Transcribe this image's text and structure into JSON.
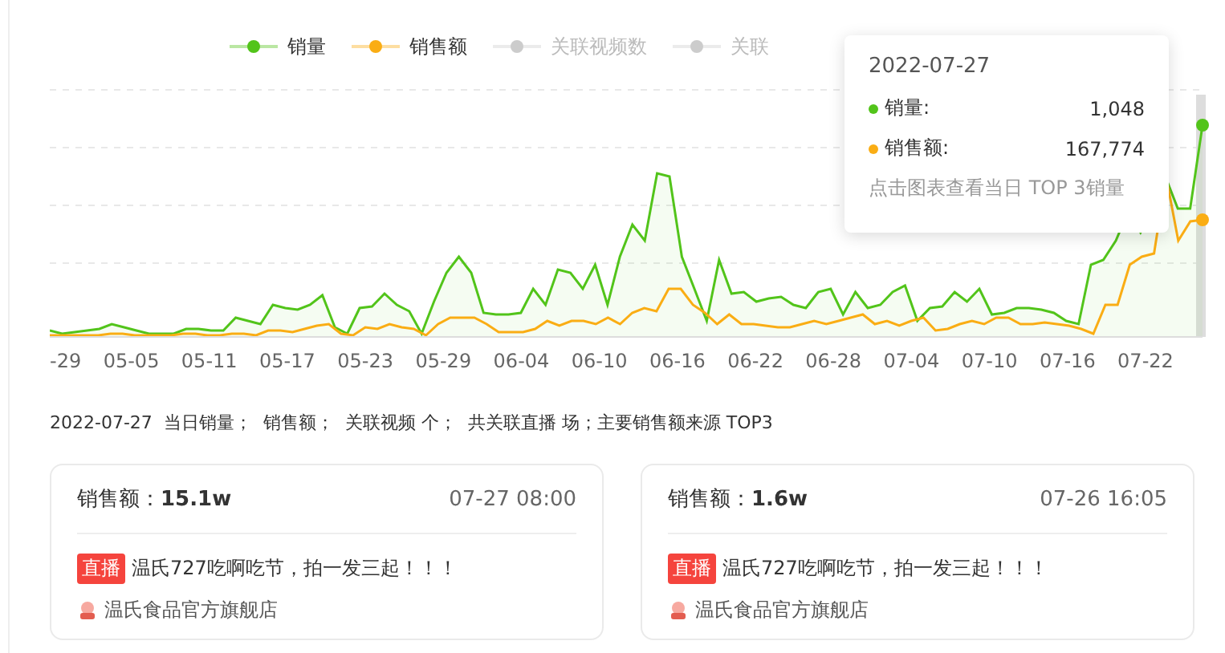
{
  "legend": [
    {
      "label": "销量",
      "on": true,
      "color": "#52c41a"
    },
    {
      "label": "销售额",
      "on": true,
      "color": "#faad14"
    },
    {
      "label": "关联视频数",
      "on": false,
      "color": "#cccccc"
    },
    {
      "label": "关联",
      "on": false,
      "color": "#cccccc"
    }
  ],
  "x_axis_labels": [
    "-29",
    "05-05",
    "05-11",
    "05-17",
    "05-23",
    "05-29",
    "06-04",
    "06-10",
    "06-16",
    "06-22",
    "06-28",
    "07-04",
    "07-10",
    "07-16",
    "07-22"
  ],
  "tooltip": {
    "date": "2022-07-27",
    "rows": [
      {
        "label": "销量:",
        "value": "1,048",
        "color": "#52c41a"
      },
      {
        "label": "销售额:",
        "value": "167,774",
        "color": "#faad14"
      }
    ],
    "hint": "点击图表查看当日 TOP 3销量"
  },
  "summary": "2022-07-27  当日销量；  销售额；  关联视频 个；  共关联直播 场；主要销售额来源 TOP3",
  "cards": [
    {
      "amount_label": "销售额：",
      "amount": "15.1w",
      "time": "07-27 08:00",
      "tag": "直播",
      "title": "温氏727吃啊吃节，拍一发三起！！！",
      "shop": "温氏食品官方旗舰店"
    },
    {
      "amount_label": "销售额：",
      "amount": "1.6w",
      "time": "07-26 16:05",
      "tag": "直播",
      "title": "温氏727吃啊吃节，拍一发三起！！！",
      "shop": "温氏食品官方旗舰店"
    }
  ]
}
